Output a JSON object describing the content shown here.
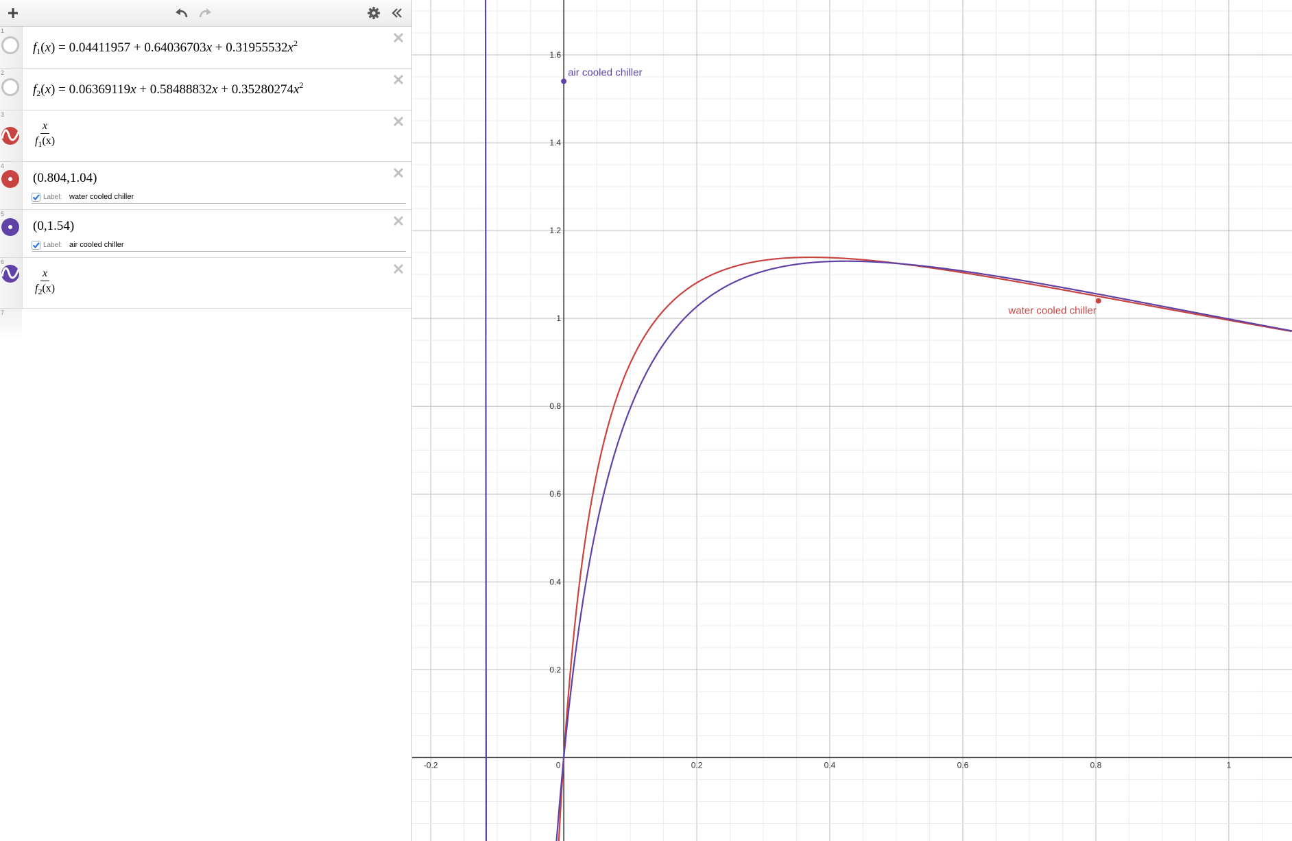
{
  "toolbar": {
    "add_icon": "plus-icon",
    "undo_icon": "undo-icon",
    "redo_icon": "redo-icon",
    "settings_icon": "gear-icon",
    "collapse_icon": "double-chevron-left-icon"
  },
  "expressions": [
    {
      "num": "1",
      "fname": "f",
      "fsub": "1",
      "rhs": "= 0.04411957 + 0.64036703",
      "term2": " + 0.31955532",
      "icon": "hidden-circle-icon"
    },
    {
      "num": "2",
      "fname": "f",
      "fsub": "2",
      "rhs": " = 0.06369119",
      "mid": " + 0.58488832",
      "term2": " + 0.35280274",
      "icon": "hidden-circle-icon"
    },
    {
      "num": "3",
      "numerator": "x",
      "den_f": "f",
      "den_sub": "1",
      "den_arg": "(x)",
      "icon": "curve-icon",
      "color": "#c74440"
    },
    {
      "num": "4",
      "point": "(0.804,1.04)",
      "label_word": "Label:",
      "label": "water cooled chiller",
      "icon": "point-icon",
      "color": "#c74440"
    },
    {
      "num": "5",
      "point": "(0,1.54)",
      "label_word": "Label:",
      "label": "air cooled chiller",
      "icon": "point-icon",
      "color": "#6042a6"
    },
    {
      "num": "6",
      "numerator": "x",
      "den_f": "f",
      "den_sub": "2",
      "den_arg": "(x)",
      "icon": "curve-icon",
      "color": "#6042a6"
    },
    {
      "num": "7"
    }
  ],
  "colors": {
    "red": "#c74440",
    "purple": "#6042a6"
  },
  "chart_data": {
    "type": "line",
    "xlim": [
      -0.228,
      1.095
    ],
    "ylim": [
      -0.19,
      1.725
    ],
    "x_ticks": [
      "-0.2",
      "0",
      "0.2",
      "0.4",
      "0.6",
      "0.8",
      "1"
    ],
    "y_ticks": [
      "0.2",
      "0.4",
      "0.6",
      "0.8",
      "1",
      "1.2",
      "1.4",
      "1.6"
    ],
    "grid": true,
    "series": [
      {
        "expr": "x/f1(x)",
        "color": "#c74440",
        "coefficients": [
          0.04411957,
          0.64036703,
          0.31955532
        ]
      },
      {
        "expr": "x/f2(x)",
        "color": "#6042a6",
        "coefficients": [
          0.06369119,
          0.58488832,
          0.35280274
        ]
      }
    ],
    "points": [
      {
        "x": 0.804,
        "y": 1.04,
        "label": "water cooled chiller",
        "color": "#c74440"
      },
      {
        "x": 0,
        "y": 1.54,
        "label": "air cooled chiller",
        "color": "#6042a6"
      }
    ]
  }
}
